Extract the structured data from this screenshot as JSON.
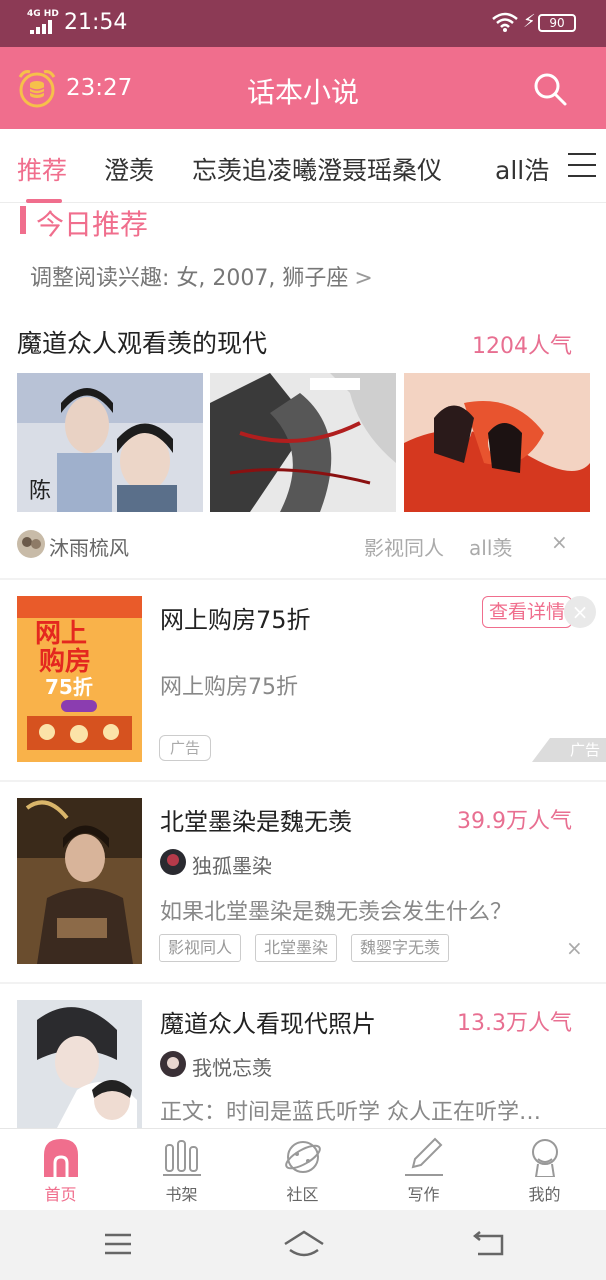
{
  "status_bar": {
    "network": "4G HD",
    "time": "21:54",
    "battery": "90"
  },
  "header": {
    "timer": "23:27",
    "title": "话本小说"
  },
  "tabs": [
    {
      "label": "推荐",
      "active": true
    },
    {
      "label": "澄羡"
    },
    {
      "label": "忘羡追凌曦澄聂瑶桑仪"
    },
    {
      "label": "all浩"
    }
  ],
  "section": {
    "title": "今日推荐",
    "interest": "调整阅读兴趣: 女, 2007, 狮子座",
    "interest_chevron": ">"
  },
  "featured": {
    "title": "魔道众人观看羡的现代",
    "popularity": "1204人气",
    "author": "沐雨梳风",
    "tags": [
      "影视同人",
      "all羡"
    ],
    "close": "×"
  },
  "ad": {
    "title": "网上购房75折",
    "desc": "网上购房75折",
    "button": "查看详情",
    "chip": "广告",
    "corner": "广告",
    "cover_text": [
      "网上",
      "购房",
      "75折"
    ]
  },
  "items": [
    {
      "title": "北堂墨染是魏无羡",
      "popularity": "39.9万人气",
      "author": "独孤墨染",
      "desc": "如果北堂墨染是魏无羡会发生什么？",
      "tags": [
        "影视同人",
        "北堂墨染",
        "魏婴字无羡"
      ],
      "close": "×"
    },
    {
      "title": "魔道众人看现代照片",
      "popularity": "13.3万人气",
      "author": "我悦忘羡",
      "desc": "正文：时间是蓝氏听学 众人正在听学…"
    }
  ],
  "bottom_nav": [
    {
      "label": "首页",
      "icon": "home-icon",
      "active": true
    },
    {
      "label": "书架",
      "icon": "bookshelf-icon"
    },
    {
      "label": "社区",
      "icon": "community-planet-icon"
    },
    {
      "label": "写作",
      "icon": "write-pen-icon"
    },
    {
      "label": "我的",
      "icon": "profile-icon"
    }
  ],
  "colors": {
    "accent": "#f06e8d",
    "statusbar": "#8c3a55",
    "popularity": "#e86f91"
  }
}
